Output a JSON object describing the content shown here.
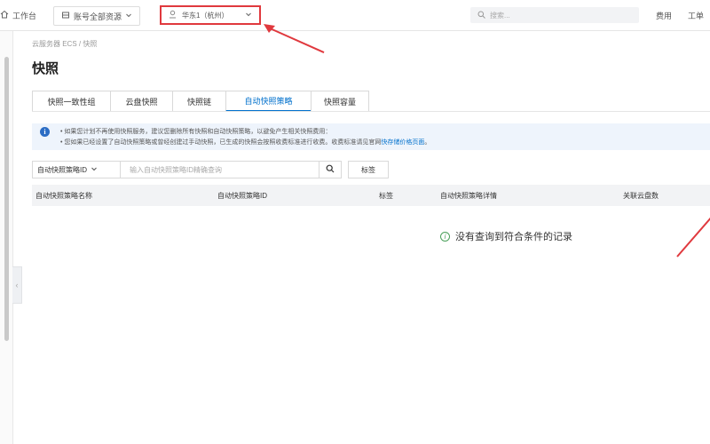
{
  "topbar": {
    "workbench": "工作台",
    "account_resources": "账号全部资源",
    "region": "华东1（杭州）",
    "search_placeholder": "搜索...",
    "fees": "费用",
    "tickets": "工单"
  },
  "breadcrumb": {
    "text": "云服务器 ECS / 快照"
  },
  "page": {
    "title": "快照"
  },
  "tabs": [
    {
      "label": "快照一致性组"
    },
    {
      "label": "云盘快照"
    },
    {
      "label": "快照链"
    },
    {
      "label": "自动快照策略",
      "active": true
    },
    {
      "label": "快照容量"
    }
  ],
  "notice": {
    "line1": "如果您计划不再使用快照服务，建议您删除所有快照和自动快照策略，以避免产生相关快照费用：",
    "line2": "您如果已经设置了自动快照策略或曾经创建过手动快照，已生成的快照会按照收费标准进行收费。收费标准请见官网",
    "line2_link": "快存储价格页面",
    "line2_end": "。"
  },
  "filter": {
    "select_value": "自动快照策略ID",
    "input_placeholder": "输入自动快照策略ID精确查询",
    "tag_button": "标签"
  },
  "table": {
    "columns": [
      "自动快照策略名称",
      "自动快照策略ID",
      "标签",
      "自动快照策略详情",
      "关联云盘数"
    ],
    "empty_text": "没有查询到符合条件的记录"
  },
  "colors": {
    "accent": "#0070cc",
    "highlight": "#e0393e",
    "notice_bg": "#eef4fc"
  }
}
